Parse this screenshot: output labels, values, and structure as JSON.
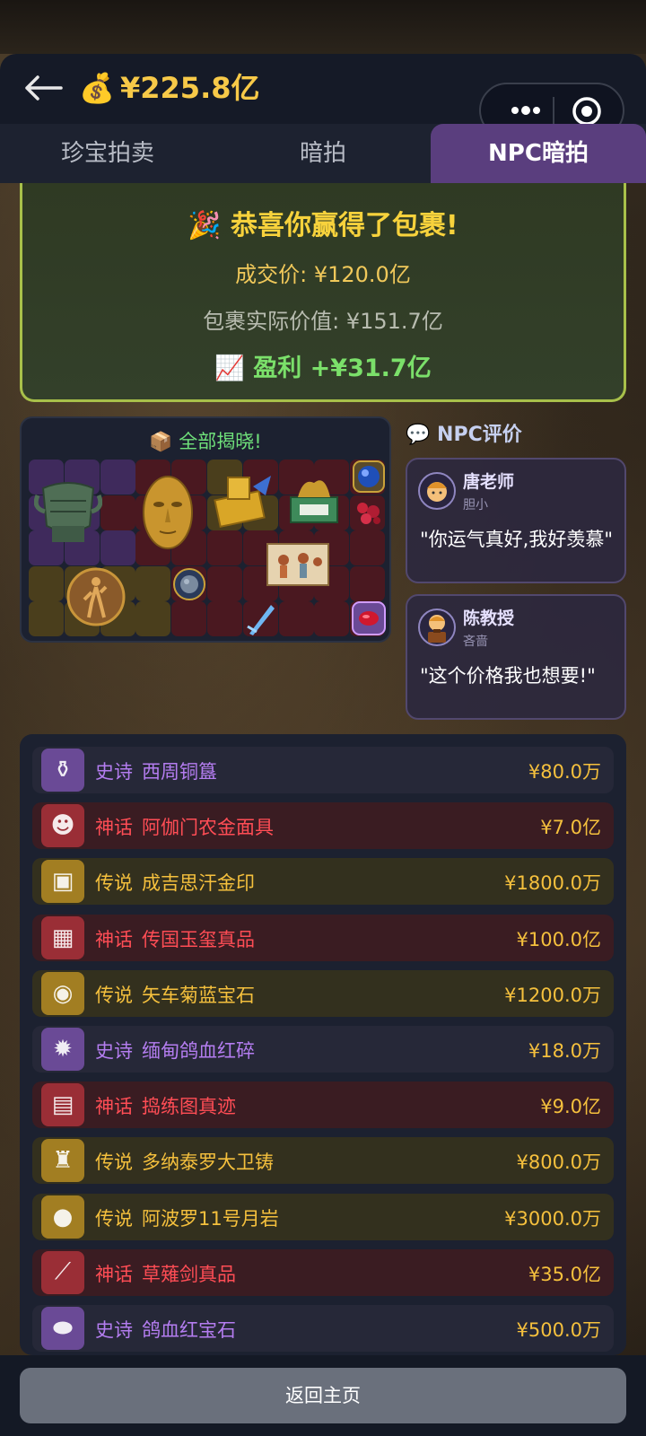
{
  "header": {
    "money_icon": "money-bag-icon",
    "money_value": "¥225.8亿"
  },
  "tabs": [
    {
      "label": "珍宝拍卖",
      "active": false
    },
    {
      "label": "暗拍",
      "active": false
    },
    {
      "label": "NPC暗拍",
      "active": true
    }
  ],
  "result": {
    "title": "🎉 恭喜你赢得了包裹!",
    "deal_price": "成交价: ¥120.0亿",
    "actual_value": "包裹实际价值: ¥151.7亿",
    "profit": "📈 盈利 +¥31.7亿"
  },
  "reveal": {
    "title": "📦 全部揭晓!"
  },
  "npc": {
    "title": "💬 NPC评价",
    "reviews": [
      {
        "name": "唐老师",
        "tag": "胆小",
        "quote": "\"你运气真好,我好羡慕\""
      },
      {
        "name": "陈教授",
        "tag": "吝啬",
        "quote": "\"这个价格我也想要!\""
      }
    ]
  },
  "items": [
    {
      "rarity": "史诗",
      "name": "西周铜簋",
      "price": "¥80.0万",
      "tier": "epic",
      "icon": "bronze-vessel-icon"
    },
    {
      "rarity": "神话",
      "name": "阿伽门农金面具",
      "price": "¥7.0亿",
      "tier": "myth",
      "icon": "gold-mask-icon"
    },
    {
      "rarity": "传说",
      "name": "成吉思汗金印",
      "price": "¥1800.0万",
      "tier": "leg",
      "icon": "gold-seal-icon"
    },
    {
      "rarity": "神话",
      "name": "传国玉玺真品",
      "price": "¥100.0亿",
      "tier": "myth",
      "icon": "jade-seal-icon"
    },
    {
      "rarity": "传说",
      "name": "矢车菊蓝宝石",
      "price": "¥1200.0万",
      "tier": "leg",
      "icon": "sapphire-icon"
    },
    {
      "rarity": "史诗",
      "name": "缅甸鸽血红碎",
      "price": "¥18.0万",
      "tier": "epic",
      "icon": "ruby-shards-icon"
    },
    {
      "rarity": "神话",
      "name": "捣练图真迹",
      "price": "¥9.0亿",
      "tier": "myth",
      "icon": "painting-scroll-icon"
    },
    {
      "rarity": "传说",
      "name": "多纳泰罗大卫铸",
      "price": "¥800.0万",
      "tier": "leg",
      "icon": "bronze-statue-icon"
    },
    {
      "rarity": "传说",
      "name": "阿波罗11号月岩",
      "price": "¥3000.0万",
      "tier": "leg",
      "icon": "moon-rock-icon"
    },
    {
      "rarity": "神话",
      "name": "草薙剑真品",
      "price": "¥35.0亿",
      "tier": "myth",
      "icon": "sword-icon"
    },
    {
      "rarity": "史诗",
      "name": "鸽血红宝石",
      "price": "¥500.0万",
      "tier": "epic",
      "icon": "ruby-icon"
    }
  ],
  "footer": {
    "home_label": "返回主页"
  }
}
